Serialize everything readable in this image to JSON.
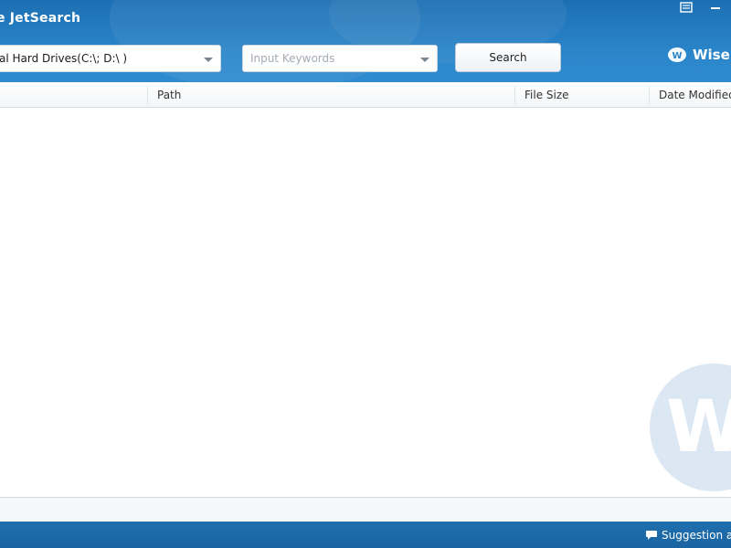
{
  "window": {
    "title": "e JetSearch"
  },
  "toolbar": {
    "drive_select_value": "al Hard Drives(C:\\; D:\\ )",
    "keywords_placeholder": "Input Keywords",
    "keywords_value": "",
    "search_label": "Search",
    "brand_text": "Wise("
  },
  "table": {
    "columns": [
      "Path",
      "File Size",
      "Date Modified"
    ],
    "rows": []
  },
  "watermark": {
    "letter": "W"
  },
  "footer": {
    "suggestion_label": "Suggestion a"
  },
  "icons": {
    "menu": "menu-icon",
    "minimize": "minimize-icon",
    "dropdown": "chevron-down-icon",
    "brand": "wise-logo-icon",
    "speech": "speech-bubble-icon"
  },
  "colors": {
    "header_blue": "#2a84c8",
    "footer_blue": "#1a64a1",
    "watermark": "#dbe7f3"
  }
}
